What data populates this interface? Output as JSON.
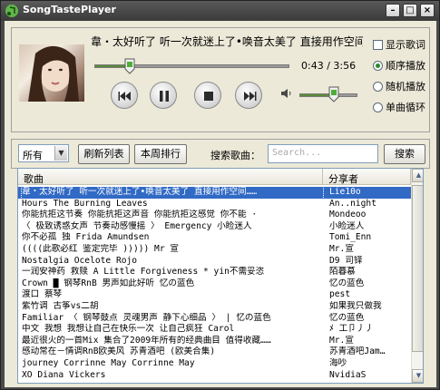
{
  "window": {
    "title": "SongTastePlayer",
    "min_label": "–",
    "max_label": "□",
    "close_label": "×"
  },
  "player": {
    "now_playing": "韋・太好听了 听一次就迷上了•唤音太美了 直接用作空间…",
    "elapsed": "0:43",
    "separator": "/",
    "duration": "3:56",
    "progress": 0.18,
    "volume": 0.6
  },
  "options": {
    "show_lyrics": "显示歌词",
    "sequential": "顺序播放",
    "shuffle": "随机播放",
    "repeat_one": "单曲循环",
    "selected": "sequential"
  },
  "toolbar": {
    "filter_value": "所有",
    "refresh_label": "刷新列表",
    "weekly_label": "本周排行",
    "search_label": "搜索歌曲：",
    "search_placeholder": "Search...",
    "search_button": "搜索"
  },
  "list": {
    "col_song": "歌曲",
    "col_sharer": "分享者",
    "rows": [
      {
        "song": "韋・太好听了 听一次就迷上了•唤音太美了 直接用作空间……",
        "sharer": "Lie10o",
        "selected": true
      },
      {
        "song": "Hours The Burning Leaves",
        "sharer": "An..night"
      },
      {
        "song": "你能抗拒这节奏 你能抗拒这声音 你能抗拒这感觉 你不能 ·",
        "sharer": "Mondeoo"
      },
      {
        "song": "〈 极致诱惑女声 节奏动感慢摇 〉 Emergency 小睑迷人",
        "sharer": "小睑迷人"
      },
      {
        "song": "你不必孤 独 Frida Amundsen",
        "sharer": "Tomi_Enn"
      },
      {
        "song": "((((此歌必红 鉴定完毕 ))))) Mr 宣",
        "sharer": "Mr.宣"
      },
      {
        "song": "Nostalgia Ocelote Rojo",
        "sharer": "D9 司铎"
      },
      {
        "song": "一润安神药 救赎 A Little Forgiveness * yin不需妥恣",
        "sharer": "陌暮慕"
      },
      {
        "song": "Crown █ 钢琴RnB 男声如此好听 忆の蓝色",
        "sharer": "忆の蓝色"
      },
      {
        "song": "渡口 蔡琴",
        "sharer": "pest"
      },
      {
        "song": "紫竹调 古筝vs二胡",
        "sharer": "如果我只做我"
      },
      {
        "song": "Familiar 〈 钢琴鼓点 灵魂男声 静下心细品 〉 | 忆の蓝色",
        "sharer": "忆の蓝色"
      },
      {
        "song": "中文 我想 我想让自己在快乐一次 让自己疯狂 Carol",
        "sharer": "ﾒ 工卩丿丿"
      },
      {
        "song": "最近很火的一首Mix 集合了2009年所有的经典曲目 值得收藏……",
        "sharer": "Mr.宣"
      },
      {
        "song": "感动常在－情调RnB欧美风 苏青酒吧 (欧美合集)",
        "sharer": "苏青酒吧Jam…"
      },
      {
        "song": "journey Corrinne May Corrinne May",
        "sharer": "海吵"
      },
      {
        "song": "XO Diana Vickers",
        "sharer": "NvidiaS"
      }
    ]
  },
  "colors": {
    "accent_green": "#2a8a2a",
    "selection": "#316ac5",
    "title_bar": "#3a3a3a"
  }
}
